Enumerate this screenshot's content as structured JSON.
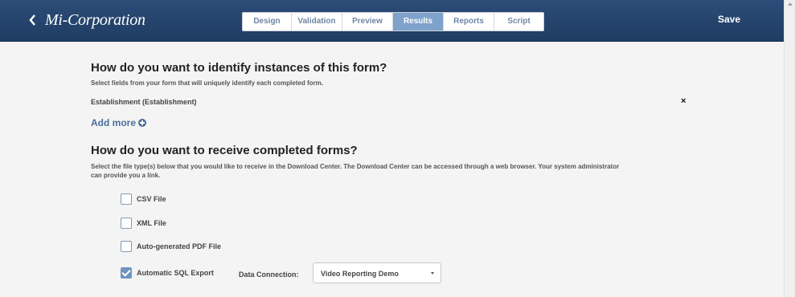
{
  "header": {
    "back_glyph": "<",
    "brand": "Mi-Corporation",
    "tabs": [
      {
        "label": "Design"
      },
      {
        "label": "Validation"
      },
      {
        "label": "Preview"
      },
      {
        "label": "Results"
      },
      {
        "label": "Reports"
      },
      {
        "label": "Script"
      }
    ],
    "active_tab": "Results",
    "save_label": "Save"
  },
  "identify": {
    "heading": "How do you want to identify instances of this form?",
    "description": "Select fields from your form that will uniquely identify each completed form.",
    "fields": [
      "Establishment (Establishment)"
    ],
    "remove_glyph": "×",
    "add_more_label": "Add more"
  },
  "receive": {
    "heading": "How do you want to receive completed forms?",
    "description_line1": "Select the file type(s) below that you would like to receive in the Download Center. The Download Center can be accessed through a web browser. Your system administrator",
    "description_line2": "can provide you a link.",
    "options": [
      {
        "label": "CSV File",
        "checked": false
      },
      {
        "label": "XML File",
        "checked": false
      },
      {
        "label": "Auto-generated PDF File",
        "checked": false
      },
      {
        "label": "Automatic SQL Export",
        "checked": true
      }
    ],
    "data_connection_label": "Data Connection:",
    "data_connection_value": "Video Reporting Demo"
  },
  "colors": {
    "header_bg": "#23426b",
    "active_tab_bg": "#7ea2c9",
    "link": "#4a6f99",
    "checkbox_checked": "#6f94c0"
  },
  "icons": [
    "chevron-left-icon",
    "plus-circle-icon",
    "close-icon",
    "checkbox-icon",
    "dropdown-arrow-icon"
  ]
}
